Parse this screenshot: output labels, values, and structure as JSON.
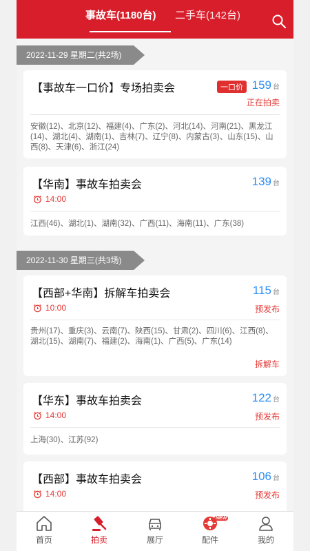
{
  "header": {
    "tabs": [
      {
        "label": "事故车(1180台)",
        "active": true
      },
      {
        "label": "二手车(142台)",
        "active": false
      }
    ],
    "search_icon": "search-icon"
  },
  "groups": [
    {
      "date": "2022-11-29 星期二(共2场)",
      "cards": [
        {
          "title": "【事故车一口价】专场拍卖会",
          "badge": "一口价",
          "count": "159",
          "unit": "台",
          "status": "正在拍卖",
          "regions": "安徽(12)、北京(12)、福建(4)、广东(2)、河北(14)、河南(21)、黑龙江(14)、湖北(4)、湖南(1)、吉林(7)、辽宁(8)、内蒙古(3)、山东(15)、山西(8)、天津(6)、浙江(24)"
        },
        {
          "title": "【华南】事故车拍卖会",
          "count": "139",
          "unit": "台",
          "time": "14:00",
          "regions": "江西(46)、湖北(1)、湖南(32)、广西(11)、海南(11)、广东(38)"
        }
      ]
    },
    {
      "date": "2022-11-30 星期三(共3场)",
      "cards": [
        {
          "title": "【西部+华南】拆解车拍卖会",
          "count": "115",
          "unit": "台",
          "time": "10:00",
          "status": "预发布",
          "regions": "贵州(17)、重庆(3)、云南(7)、陕西(15)、甘肃(2)、四川(6)、江西(8)、湖北(15)、湖南(7)、福建(2)、海南(1)、广西(5)、广东(14)",
          "tag": "拆解车"
        },
        {
          "title": "【华东】事故车拍卖会",
          "count": "122",
          "unit": "台",
          "time": "14:00",
          "status": "预发布",
          "regions": "上海(30)、江苏(92)"
        },
        {
          "title": "【西部】事故车拍卖会",
          "count": "106",
          "unit": "台",
          "time": "14:00",
          "status": "预发布"
        }
      ]
    }
  ],
  "bottom_nav": [
    {
      "label": "首页",
      "icon": "home-icon",
      "active": false
    },
    {
      "label": "拍卖",
      "icon": "gavel-icon",
      "active": true
    },
    {
      "label": "展厅",
      "icon": "car-icon",
      "active": false
    },
    {
      "label": "配件",
      "icon": "parts-icon",
      "active": false,
      "badge": "NEW"
    },
    {
      "label": "我的",
      "icon": "user-icon",
      "active": false
    }
  ],
  "colors": {
    "brand": "#d81e2b",
    "count_blue": "#2c8ef4",
    "status_red": "#e53935"
  }
}
